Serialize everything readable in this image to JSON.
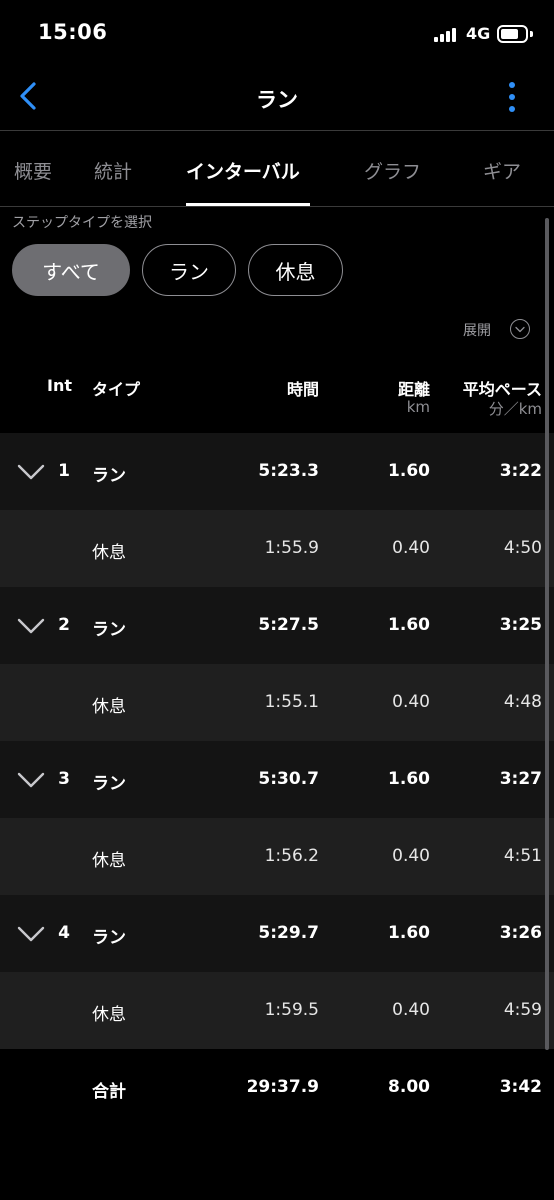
{
  "status_bar": {
    "time": "15:06",
    "network": "4G"
  },
  "nav": {
    "title": "ラン"
  },
  "tabs": [
    {
      "label": "概要"
    },
    {
      "label": "統計"
    },
    {
      "label": "インターバル"
    },
    {
      "label": "グラフ"
    },
    {
      "label": "ギア"
    }
  ],
  "active_tab": "インターバル",
  "filter": {
    "label": "ステップタイプを選択",
    "chips": [
      {
        "label": "すべて",
        "selected": true
      },
      {
        "label": "ラン",
        "selected": false
      },
      {
        "label": "休息",
        "selected": false
      }
    ]
  },
  "expand_label": "展開",
  "table": {
    "headers": {
      "int": "Int",
      "type": "タイプ",
      "time": "時間",
      "distance": "距離",
      "distance_unit": "km",
      "pace": "平均ペース",
      "pace_unit": "分／km"
    },
    "rows": [
      {
        "int": "1",
        "type": "ラン",
        "time": "5:23.3",
        "distance": "1.60",
        "pace": "3:22"
      },
      {
        "int": "",
        "type": "休息",
        "time": "1:55.9",
        "distance": "0.40",
        "pace": "4:50"
      },
      {
        "int": "2",
        "type": "ラン",
        "time": "5:27.5",
        "distance": "1.60",
        "pace": "3:25"
      },
      {
        "int": "",
        "type": "休息",
        "time": "1:55.1",
        "distance": "0.40",
        "pace": "4:48"
      },
      {
        "int": "3",
        "type": "ラン",
        "time": "5:30.7",
        "distance": "1.60",
        "pace": "3:27"
      },
      {
        "int": "",
        "type": "休息",
        "time": "1:56.2",
        "distance": "0.40",
        "pace": "4:51"
      },
      {
        "int": "4",
        "type": "ラン",
        "time": "5:29.7",
        "distance": "1.60",
        "pace": "3:26"
      },
      {
        "int": "",
        "type": "休息",
        "time": "1:59.5",
        "distance": "0.40",
        "pace": "4:59"
      }
    ],
    "total": {
      "label": "合計",
      "time": "29:37.9",
      "distance": "8.00",
      "pace": "3:42"
    }
  },
  "colors": {
    "accent": "#2f8ff7",
    "background": "#000000",
    "run_row": "#141414",
    "rest_row": "#1f1f1f",
    "chip_selected": "#6e6e72"
  }
}
